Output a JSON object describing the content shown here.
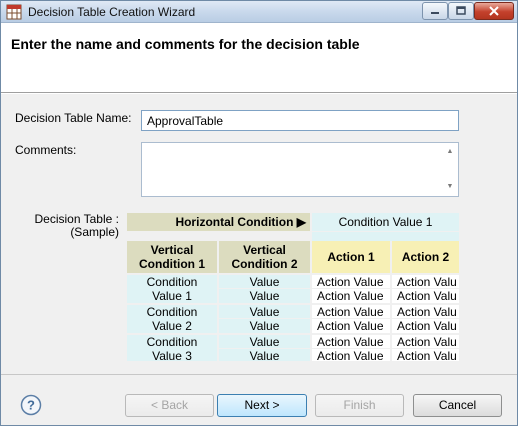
{
  "window": {
    "title": "Decision Table Creation Wizard",
    "icon": "decision-table-app-icon",
    "controls": [
      "minimize-icon",
      "maximize-icon",
      "close-icon"
    ]
  },
  "header": {
    "title": "Enter the name and comments for the decision table"
  },
  "form": {
    "name_label": "Decision Table Name:",
    "name_value": "ApprovalTable",
    "comments_label": "Comments:",
    "comments_value": ""
  },
  "sample": {
    "label_line1": "Decision Table :",
    "label_line2": "(Sample)",
    "horizontal_condition": "Horizontal Condition",
    "condition_value_1": "Condition Value 1",
    "vertical_condition_1_line1": "Vertical",
    "vertical_condition_1_line2": "Condition 1",
    "vertical_condition_2_line1": "Vertical",
    "vertical_condition_2_line2": "Condition 2",
    "action_1": "Action 1",
    "action_2": "Action 2",
    "rows": [
      {
        "cond_line1": "Condition",
        "cond_line2": "Value 1",
        "values": [
          "Value",
          "Value"
        ],
        "action1": [
          "Action Value",
          "Action Value"
        ],
        "action2": [
          "Action Valu",
          "Action Valu"
        ]
      },
      {
        "cond_line1": "Condition",
        "cond_line2": "Value 2",
        "values": [
          "Value",
          "Value"
        ],
        "action1": [
          "Action Value",
          "Action Value"
        ],
        "action2": [
          "Action Valu",
          "Action Valu"
        ]
      },
      {
        "cond_line1": "Condition",
        "cond_line2": "Value 3",
        "values": [
          "Value",
          "Value"
        ],
        "action1": [
          "Action Value",
          "Action Value"
        ],
        "action2": [
          "Action Valu",
          "Action Valu"
        ]
      }
    ]
  },
  "footer": {
    "help_icon": "help-icon",
    "back_label": "< Back",
    "next_label": "Next >",
    "finish_label": "Finish",
    "cancel_label": "Cancel"
  },
  "colors": {
    "title_bar": "#c9d9ec",
    "condition_header": "#dcdcbf",
    "action_header": "#f7f0b5",
    "condition_value": "#dff3f5",
    "close_button": "#c4412c"
  }
}
